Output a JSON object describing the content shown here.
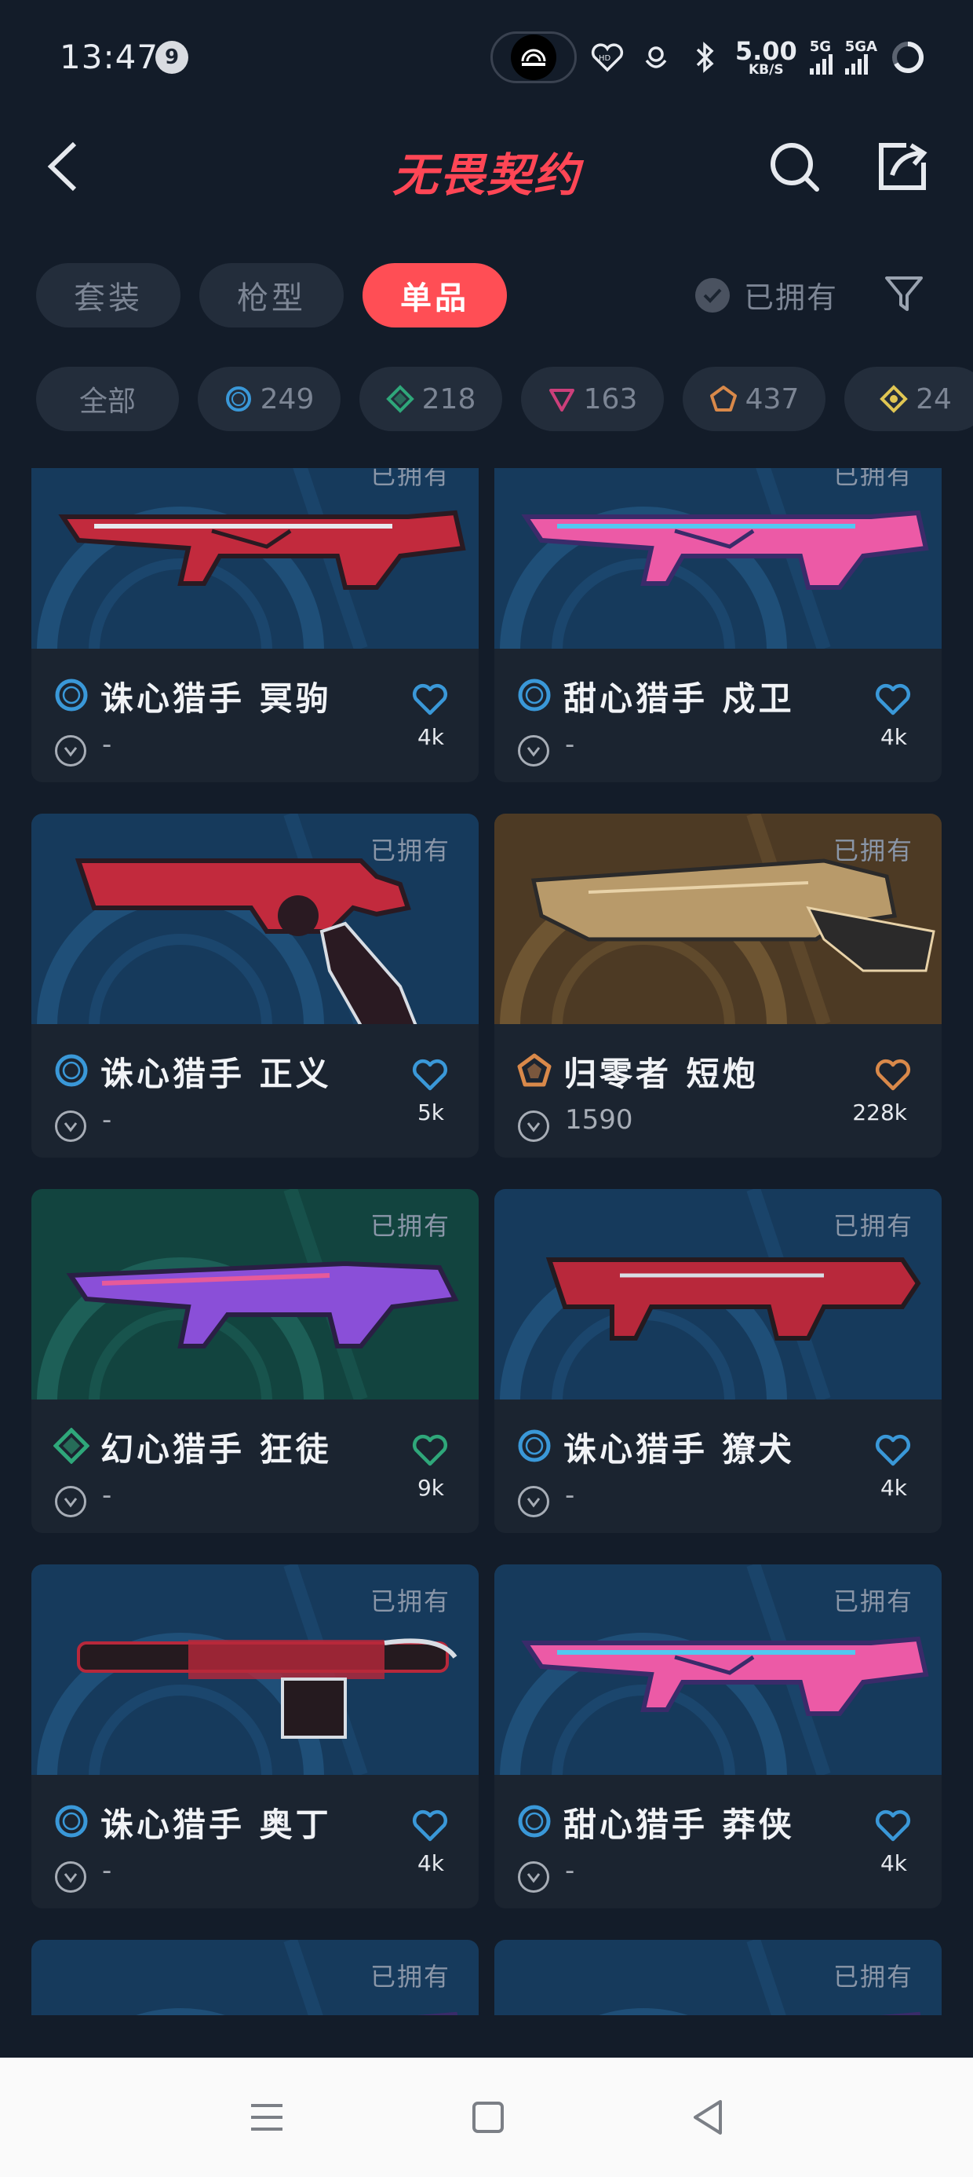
{
  "status_bar": {
    "time": "13:47",
    "notification_count": "9",
    "net_speed_value": "5.00",
    "net_speed_unit": "KB/S",
    "sim1_label": "5G",
    "sim2_label": "5GA"
  },
  "app_bar": {
    "title": "无畏契约"
  },
  "type_tabs": [
    {
      "label": "套装",
      "active": false
    },
    {
      "label": "枪型",
      "active": false
    },
    {
      "label": "单品",
      "active": true
    }
  ],
  "owned_filter_label": "已拥有",
  "rarity_chips": [
    {
      "label": "全部",
      "icon": "all"
    },
    {
      "label": "249",
      "icon": "select-tier-icon",
      "color": "#3a98d8"
    },
    {
      "label": "218",
      "icon": "deluxe-tier-icon",
      "color": "#2fa77a"
    },
    {
      "label": "163",
      "icon": "premium-tier-icon",
      "color": "#cc3f7a"
    },
    {
      "label": "437",
      "icon": "exclusive-tier-icon",
      "color": "#d9894a"
    },
    {
      "label": "24",
      "icon": "ultra-tier-icon",
      "color": "#e0c653"
    }
  ],
  "cards": [
    {
      "owned": "已拥有",
      "name": "诛心猎手 冥驹",
      "tier": "select",
      "price": "-",
      "likes": "4k",
      "art": "blue",
      "gun": "sniper-red"
    },
    {
      "owned": "已拥有",
      "name": "甜心猎手 戍卫",
      "tier": "select",
      "price": "-",
      "likes": "4k",
      "art": "blue",
      "gun": "rifle-pink"
    },
    {
      "owned": "已拥有",
      "name": "诛心猎手 正义",
      "tier": "select",
      "price": "-",
      "likes": "5k",
      "art": "blue",
      "gun": "revolver-red"
    },
    {
      "owned": "已拥有",
      "name": "归零者 短炮",
      "tier": "exclusive",
      "price": "1590",
      "likes": "228k",
      "art": "gold",
      "gun": "pistol-gold"
    },
    {
      "owned": "已拥有",
      "name": "幻心猎手 狂徒",
      "tier": "deluxe",
      "price": "-",
      "likes": "9k",
      "art": "green",
      "gun": "rifle-purple"
    },
    {
      "owned": "已拥有",
      "name": "诛心猎手 獠犬",
      "tier": "select",
      "price": "-",
      "likes": "4k",
      "art": "blue",
      "gun": "smg-red"
    },
    {
      "owned": "已拥有",
      "name": "诛心猎手 奥丁",
      "tier": "select",
      "price": "-",
      "likes": "4k",
      "art": "blue",
      "gun": "lmg-red"
    },
    {
      "owned": "已拥有",
      "name": "甜心猎手 莽侠",
      "tier": "select",
      "price": "-",
      "likes": "4k",
      "art": "blue",
      "gun": "rifle-pink2"
    },
    {
      "owned": "已拥有",
      "name": "",
      "tier": "select",
      "price": "",
      "likes": "",
      "art": "blue",
      "gun": "rifle-pink3"
    },
    {
      "owned": "已拥有",
      "name": "",
      "tier": "select",
      "price": "",
      "likes": "",
      "art": "blue",
      "gun": "rifle-pink4"
    }
  ],
  "tier_colors": {
    "select": "#3a98d8",
    "deluxe": "#2fa77a",
    "exclusive": "#d9894a"
  },
  "accent_color": "#ff4e55"
}
